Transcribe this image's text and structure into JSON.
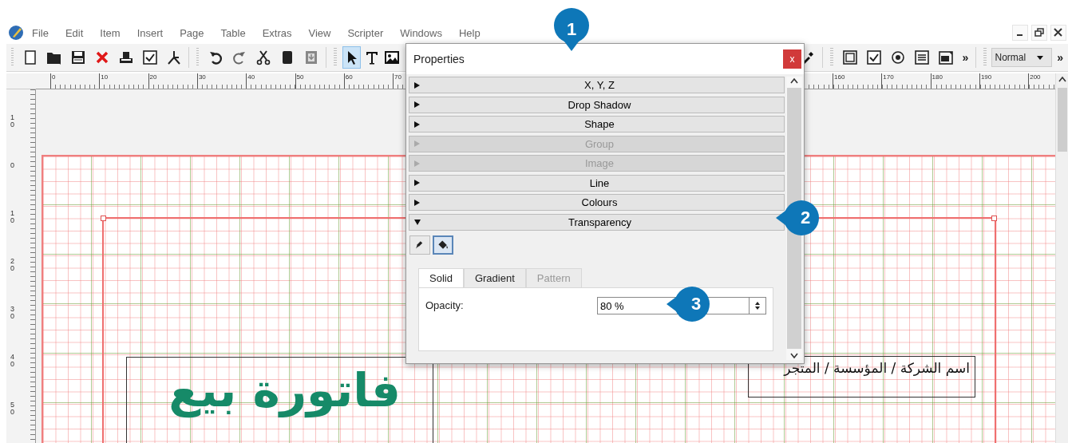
{
  "menu_bar": {
    "items": [
      "File",
      "Edit",
      "Item",
      "Insert",
      "Page",
      "Table",
      "Extras",
      "View",
      "Scripter",
      "Windows",
      "Help"
    ]
  },
  "toolbar": {
    "tools": [
      {
        "kind": "select",
        "selected": true
      },
      {
        "kind": "text",
        "selected": false
      },
      {
        "kind": "image",
        "selected": false
      }
    ],
    "overflow_marks": [
      "»",
      "»"
    ],
    "style_dropdown": {
      "value": "Normal"
    }
  },
  "horizontal_ruler": {
    "groups": [
      {
        "labels": [
          "0",
          "10",
          "20",
          "30",
          "40",
          "50",
          "60",
          "70"
        ]
      },
      {
        "labels": [
          "160",
          "170",
          "180",
          "190",
          "200"
        ]
      }
    ]
  },
  "vertical_ruler": {
    "labels": [
      "10",
      "0",
      "10",
      "20",
      "30",
      "40",
      "50"
    ]
  },
  "document": {
    "title_text": "فاتورة بيع",
    "company_text": "اسم الشركة / المؤسسة / المتجر"
  },
  "properties_dialog": {
    "title": "Properties",
    "close": "x",
    "sections": [
      {
        "label": "X, Y, Z",
        "disabled": false,
        "expanded": false
      },
      {
        "label": "Drop Shadow",
        "disabled": false,
        "expanded": false
      },
      {
        "label": "Shape",
        "disabled": false,
        "expanded": false
      },
      {
        "label": "Group",
        "disabled": true,
        "expanded": false
      },
      {
        "label": "Image",
        "disabled": true,
        "expanded": false
      },
      {
        "label": "Line",
        "disabled": false,
        "expanded": false
      },
      {
        "label": "Colours",
        "disabled": false,
        "expanded": false
      },
      {
        "label": "Transparency",
        "disabled": false,
        "expanded": true
      }
    ],
    "mode_buttons": [
      {
        "kind": "pen",
        "selected": false
      },
      {
        "kind": "bucket",
        "selected": true
      }
    ],
    "tabs": [
      {
        "label": "Solid",
        "selected": true,
        "disabled": false
      },
      {
        "label": "Gradient",
        "selected": false,
        "disabled": false
      },
      {
        "label": "Pattern",
        "selected": false,
        "disabled": true
      }
    ],
    "opacity": {
      "label": "Opacity:",
      "value": "80 %"
    }
  },
  "callouts": [
    {
      "number": "1"
    },
    {
      "number": "2"
    },
    {
      "number": "3"
    }
  ]
}
